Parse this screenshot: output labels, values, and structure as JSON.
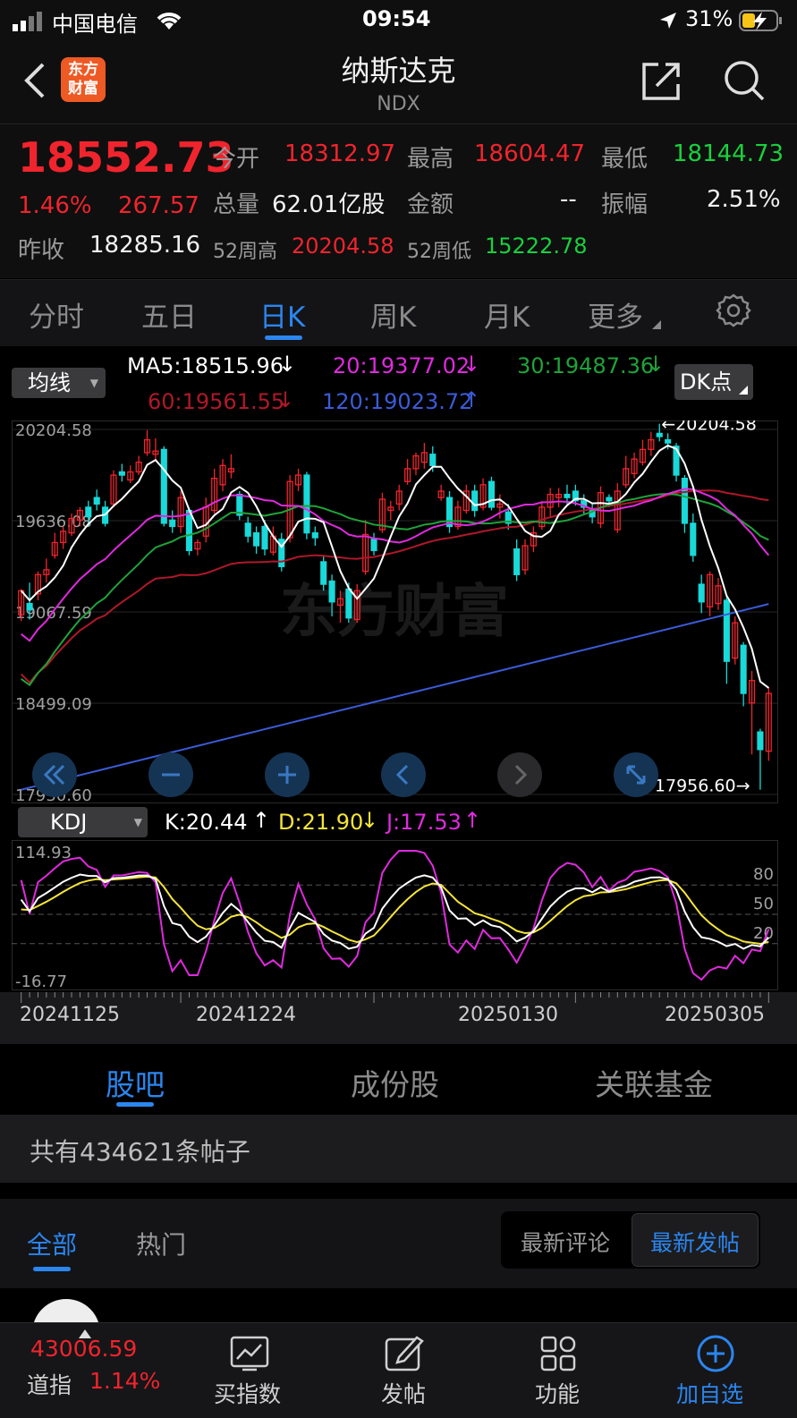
{
  "status_bar": {
    "carrier": "中国电信",
    "time": "09:54",
    "battery": "31%"
  },
  "nav": {
    "title": "纳斯达克",
    "subtitle": "NDX",
    "logo_line1": "东方",
    "logo_line2": "财富"
  },
  "quote": {
    "price": "18552.73",
    "change_pct": "1.46%",
    "change": "267.57",
    "prev_close_label": "昨收",
    "prev_close": "18285.16",
    "open_label": "今开",
    "open": "18312.97",
    "high_label": "最高",
    "high": "18604.47",
    "low_label": "最低",
    "low": "18144.73",
    "volume_label": "总量",
    "volume": "62.01亿股",
    "amount_label": "金额",
    "amount": "--",
    "amplitude_label": "振幅",
    "amplitude": "2.51%",
    "high52_label": "52周高",
    "high52": "20204.58",
    "low52_label": "52周低",
    "low52": "15222.78"
  },
  "period_tabs": [
    "分时",
    "五日",
    "日K",
    "周K",
    "月K",
    "更多"
  ],
  "period_active": 2,
  "indicator": {
    "selector": "均线",
    "ma5": "MA5:18515.96",
    "ma20": "20:19377.02",
    "ma30": "30:19487.36",
    "ma60": "60:19561.55",
    "ma120": "120:19023.72",
    "dk_button": "DK点"
  },
  "kdj": {
    "selector": "KDJ",
    "k": "K:20.44",
    "d": "D:21.90",
    "j": "J:17.53",
    "top": "114.93",
    "bottom": "-16.77",
    "levels": [
      "80",
      "50",
      "20"
    ]
  },
  "chart_data": {
    "type": "candlestick",
    "y_ticks": [
      "20204.58",
      "19636.08",
      "19067.59",
      "18499.09",
      "17930.60"
    ],
    "ylim": [
      17930.6,
      20204.58
    ],
    "max_marker": "20204.58",
    "min_marker": "17956.60",
    "x_ticks": [
      "20241125",
      "20241224",
      "20250130",
      "20250305"
    ],
    "candles": [
      [
        19050,
        19200,
        19010,
        19210
      ],
      [
        19120,
        19080,
        19020,
        19250
      ],
      [
        19180,
        19300,
        19140,
        19320
      ],
      [
        19300,
        19330,
        19250,
        19400
      ],
      [
        19420,
        19500,
        19400,
        19560
      ],
      [
        19500,
        19570,
        19460,
        19600
      ],
      [
        19560,
        19650,
        19540,
        19680
      ],
      [
        19640,
        19700,
        19600,
        19720
      ],
      [
        19720,
        19660,
        19600,
        19760
      ],
      [
        19780,
        19740,
        19700,
        19830
      ],
      [
        19720,
        19620,
        19600,
        19760
      ],
      [
        19740,
        19920,
        19720,
        19950
      ],
      [
        19940,
        19920,
        19880,
        19990
      ],
      [
        19890,
        19940,
        19870,
        19980
      ],
      [
        19940,
        20000,
        19920,
        20040
      ],
      [
        20060,
        20140,
        20040,
        20200
      ],
      [
        20050,
        20070,
        20020,
        20150
      ],
      [
        20080,
        19620,
        19600,
        20100
      ],
      [
        19640,
        19600,
        19560,
        19700
      ],
      [
        19600,
        19780,
        19560,
        19820
      ],
      [
        19700,
        19450,
        19420,
        19720
      ],
      [
        19460,
        19500,
        19420,
        19520
      ],
      [
        19540,
        19720,
        19500,
        19780
      ],
      [
        19700,
        19900,
        19680,
        19960
      ],
      [
        19860,
        19980,
        19820,
        20020
      ],
      [
        19940,
        19960,
        19900,
        20050
      ],
      [
        19800,
        19670,
        19640,
        19820
      ],
      [
        19620,
        19540,
        19500,
        19660
      ],
      [
        19560,
        19480,
        19430,
        19600
      ],
      [
        19600,
        19460,
        19420,
        19640
      ],
      [
        19440,
        19540,
        19420,
        19600
      ],
      [
        19520,
        19350,
        19320,
        19560
      ],
      [
        19530,
        19880,
        19500,
        19920
      ],
      [
        19860,
        19920,
        19820,
        19960
      ],
      [
        19920,
        19560,
        19520,
        19940
      ],
      [
        19560,
        19530,
        19480,
        19600
      ],
      [
        19380,
        19240,
        19200,
        19420
      ],
      [
        19260,
        19130,
        19040,
        19300
      ],
      [
        19110,
        19150,
        19000,
        19200
      ],
      [
        19210,
        19030,
        19000,
        19250
      ],
      [
        19020,
        19200,
        19000,
        19240
      ],
      [
        19320,
        19550,
        19300,
        19640
      ],
      [
        19520,
        19450,
        19420,
        19560
      ],
      [
        19580,
        19770,
        19560,
        19810
      ],
      [
        19700,
        19720,
        19640,
        19760
      ],
      [
        19740,
        19820,
        19700,
        19860
      ],
      [
        19880,
        19960,
        19860,
        20020
      ],
      [
        19960,
        20040,
        19920,
        20060
      ],
      [
        20000,
        20060,
        19960,
        20120
      ],
      [
        20050,
        19980,
        19940,
        20100
      ],
      [
        19780,
        19820,
        19760,
        19860
      ],
      [
        19780,
        19600,
        19560,
        19820
      ],
      [
        19600,
        19720,
        19580,
        19760
      ],
      [
        19700,
        19820,
        19680,
        19860
      ],
      [
        19820,
        19700,
        19660,
        19860
      ],
      [
        19720,
        19860,
        19700,
        19900
      ],
      [
        19880,
        19720,
        19700,
        19910
      ],
      [
        19720,
        19740,
        19650,
        19800
      ],
      [
        19690,
        19620,
        19580,
        19740
      ],
      [
        19460,
        19300,
        19260,
        19520
      ],
      [
        19330,
        19480,
        19300,
        19520
      ],
      [
        19480,
        19560,
        19440,
        19600
      ],
      [
        19600,
        19720,
        19580,
        19760
      ],
      [
        19720,
        19800,
        19660,
        19840
      ],
      [
        19780,
        19800,
        19720,
        19840
      ],
      [
        19800,
        19780,
        19740,
        19860
      ],
      [
        19820,
        19760,
        19730,
        19860
      ],
      [
        19760,
        19720,
        19680,
        19800
      ],
      [
        19700,
        19660,
        19620,
        19740
      ],
      [
        19620,
        19810,
        19590,
        19850
      ],
      [
        19780,
        19760,
        19720,
        19800
      ],
      [
        19580,
        19820,
        19560,
        19870
      ],
      [
        19860,
        19960,
        19840,
        20040
      ],
      [
        19930,
        20020,
        19900,
        20060
      ],
      [
        20000,
        20080,
        19980,
        20140
      ],
      [
        20080,
        20140,
        20040,
        20190
      ],
      [
        20180,
        20160,
        20130,
        20240
      ],
      [
        20140,
        20120,
        20080,
        20180
      ],
      [
        20100,
        19920,
        19880,
        20120
      ],
      [
        19900,
        19620,
        19560,
        19920
      ],
      [
        19620,
        19420,
        19380,
        19680
      ],
      [
        19240,
        19130,
        19060,
        19300
      ],
      [
        19100,
        19300,
        19040,
        19320
      ],
      [
        19120,
        19230,
        19080,
        19280
      ],
      [
        19140,
        18760,
        18620,
        19160
      ],
      [
        18780,
        19000,
        18740,
        19040
      ],
      [
        18860,
        18560,
        18480,
        18880
      ],
      [
        18500,
        18640,
        18180,
        18700
      ],
      [
        18320,
        18210,
        17960,
        18340
      ],
      [
        18200,
        18560,
        18140,
        18600
      ]
    ]
  },
  "sections": {
    "tabs": [
      "股吧",
      "成份股",
      "关联基金"
    ],
    "active": 0,
    "post_count": "共有434621条帖子",
    "sub_tabs": [
      "全部",
      "热门"
    ],
    "sub_active": 0,
    "sort_options": [
      "最新评论",
      "最新发帖"
    ],
    "sort_active": 1
  },
  "bottom_bar": {
    "index_value": "43006.59",
    "index_name": "道指",
    "index_change": "1.14%",
    "items": [
      "买指数",
      "发帖",
      "功能",
      "加自选"
    ]
  },
  "colors": {
    "up": "#f0242d",
    "down": "#19d9d9",
    "ma5": "#ffffff",
    "ma20": "#e02adf",
    "ma30": "#1fa33a",
    "ma60": "#b0182a",
    "ma120": "#3b5bd8",
    "accent": "#2b86f0",
    "kdj_d": "#f6e43a"
  }
}
